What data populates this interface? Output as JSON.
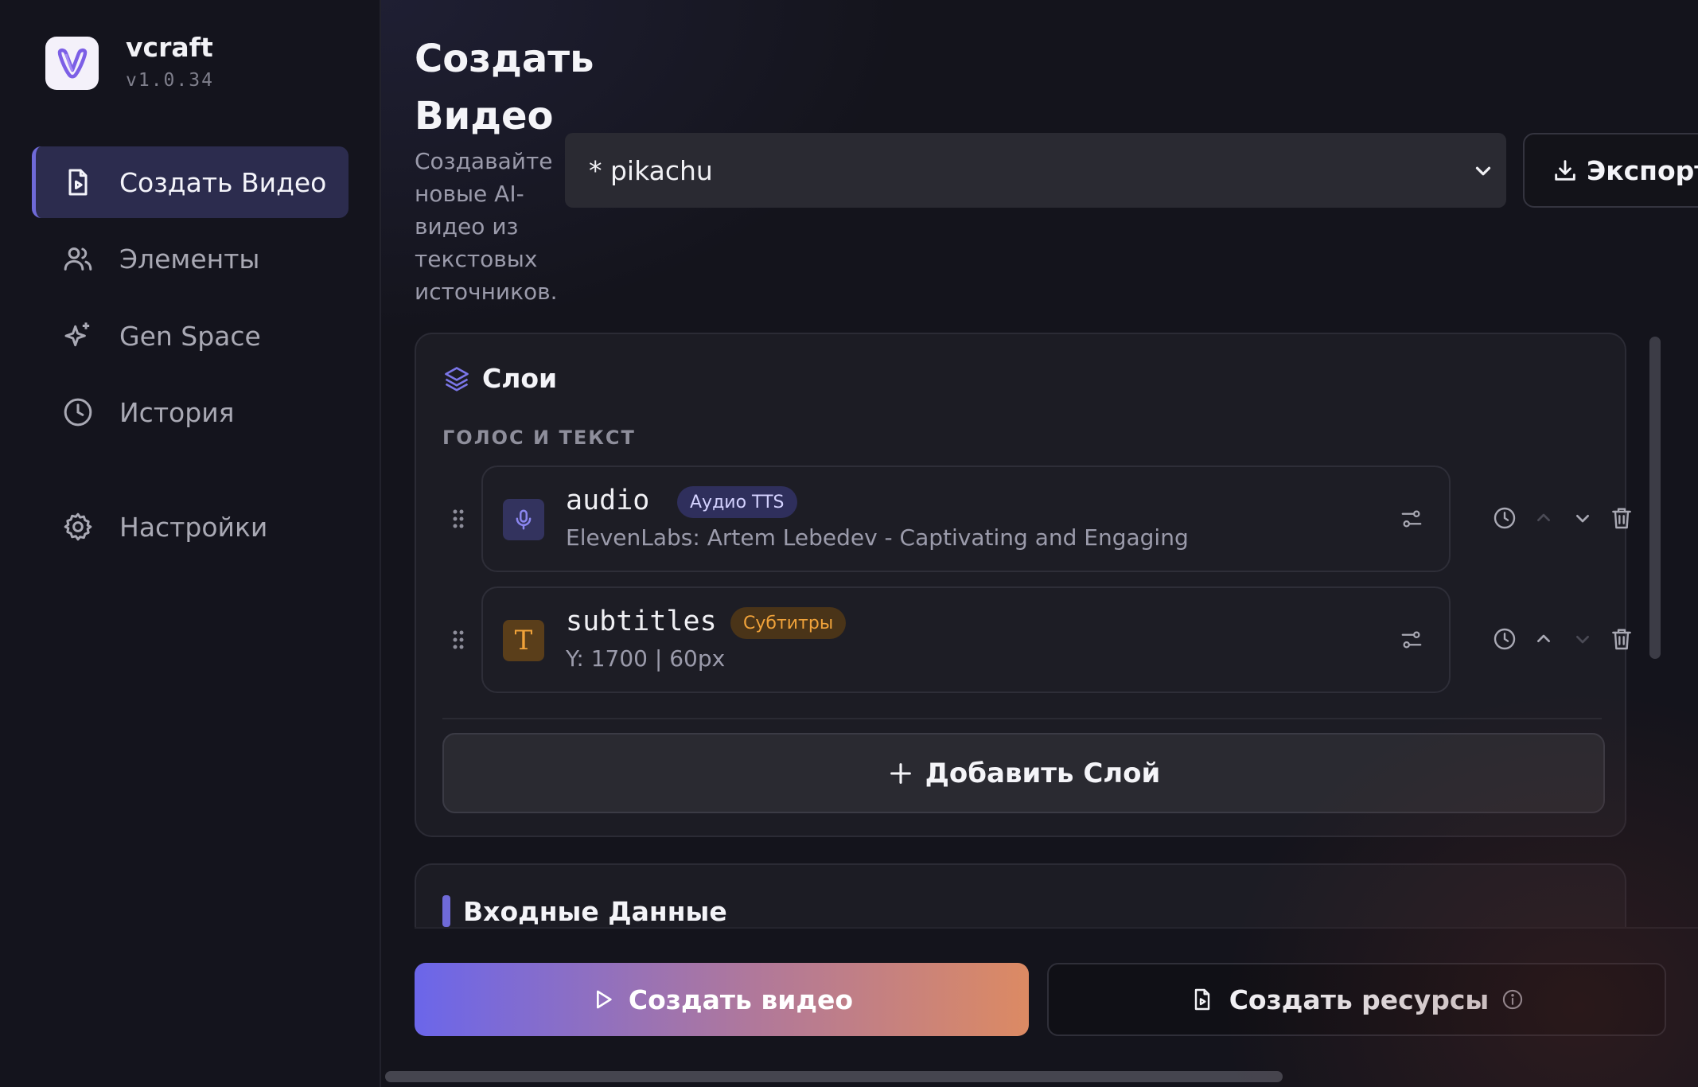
{
  "app": {
    "name": "vcraft",
    "version": "v1.0.34"
  },
  "sidebar": {
    "items": [
      {
        "label": "Создать Видео",
        "icon": "file-video-icon",
        "active": true
      },
      {
        "label": "Элементы",
        "icon": "users-icon",
        "active": false
      },
      {
        "label": "Gen Space",
        "icon": "sparkles-icon",
        "active": false
      },
      {
        "label": "История",
        "icon": "clock-icon",
        "active": false
      },
      {
        "label": "Настройки",
        "icon": "gear-icon",
        "active": false
      }
    ]
  },
  "header": {
    "title": "Создать Видео",
    "description": "Создавайте новые AI-видео из текстовых источников.",
    "project_select": {
      "value": "* pikachu"
    },
    "export_label": "Экспорт"
  },
  "layers": {
    "title": "Слои",
    "section_label": "ГОЛОС И ТЕКСТ",
    "items": [
      {
        "name": "audio",
        "badge": "Аудио TTS",
        "subtitle": "ElevenLabs: Artem Lebedev - Captivating and Engaging",
        "icon": "microphone-icon",
        "move_up_enabled": false,
        "move_down_enabled": true
      },
      {
        "name": "subtitles",
        "badge": "Субтитры",
        "subtitle": "Y: 1700 | 60px",
        "icon": "text-t-icon",
        "icon_glyph": "T",
        "move_up_enabled": true,
        "move_down_enabled": false
      }
    ],
    "add_label": "Добавить Слой"
  },
  "input_section": {
    "title": "Входные Данные"
  },
  "actions": {
    "create_video": "Создать видео",
    "create_resources": "Создать ресурсы"
  },
  "colors": {
    "accent": "#6f6ad8",
    "audio_badge_bg": "#2f2f5c",
    "subtitles_badge_bg": "#4a3418",
    "subtitles_badge_text": "#f0a23a"
  }
}
